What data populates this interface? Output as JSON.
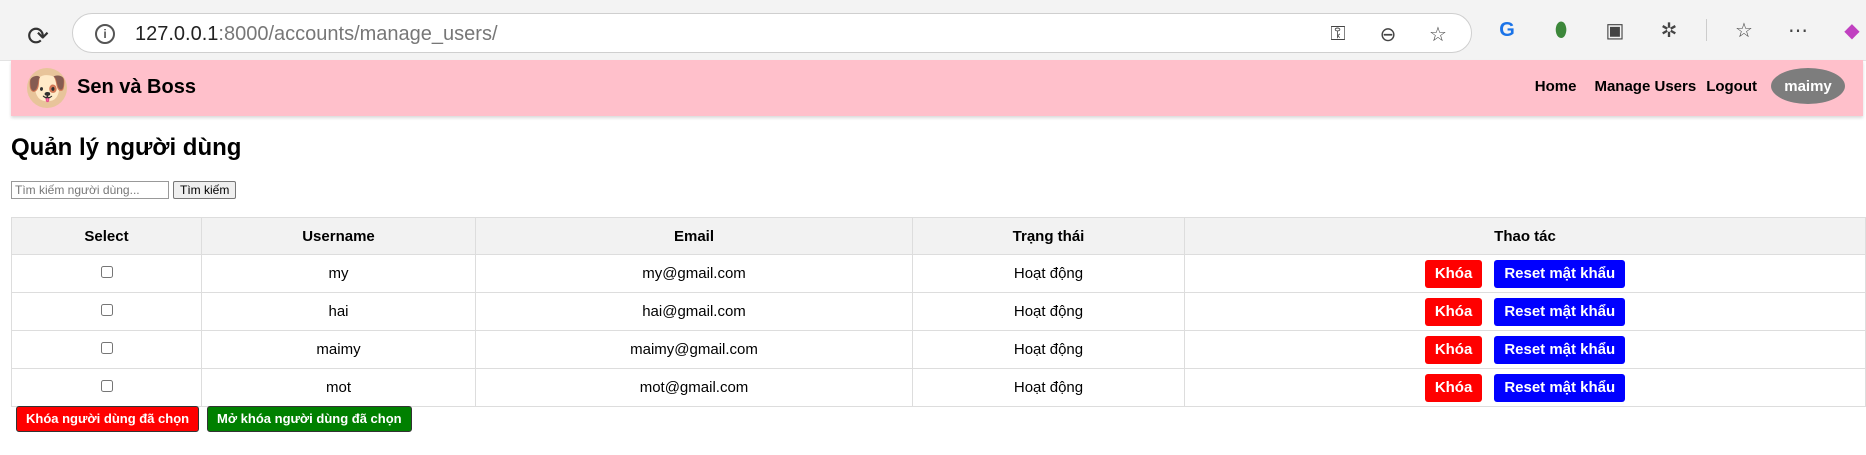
{
  "browser": {
    "url_host": "127.0.0.1",
    "url_rest": ":8000/accounts/manage_users/"
  },
  "navbar": {
    "brand": "Sen và Boss",
    "logo_emoji": "🐶",
    "links": [
      "Home",
      "Manage Users",
      "Logout"
    ],
    "user": "maimy",
    "background": "#ffc0cb"
  },
  "page": {
    "title": "Quản lý người dùng"
  },
  "search": {
    "placeholder": "Tìm kiếm người dùng...",
    "button": "Tìm kiếm"
  },
  "table": {
    "headers": [
      "Select",
      "Username",
      "Email",
      "Trạng thái",
      "Thao tác"
    ],
    "rows": [
      {
        "username": "my",
        "email": "my@gmail.com",
        "status": "Hoạt động"
      },
      {
        "username": "hai",
        "email": "hai@gmail.com",
        "status": "Hoạt động"
      },
      {
        "username": "maimy",
        "email": "maimy@gmail.com",
        "status": "Hoạt động"
      },
      {
        "username": "mot",
        "email": "mot@gmail.com",
        "status": "Hoạt động"
      }
    ],
    "lock_label": "Khóa",
    "reset_label": "Reset mật khẩu"
  },
  "bulk": {
    "lock_selected": "Khóa người dùng đã chọn",
    "unlock_selected": "Mở khóa người dùng đã chọn"
  },
  "colors": {
    "lock": "#ff0000",
    "reset": "#0000ff",
    "unlock": "#008000"
  }
}
